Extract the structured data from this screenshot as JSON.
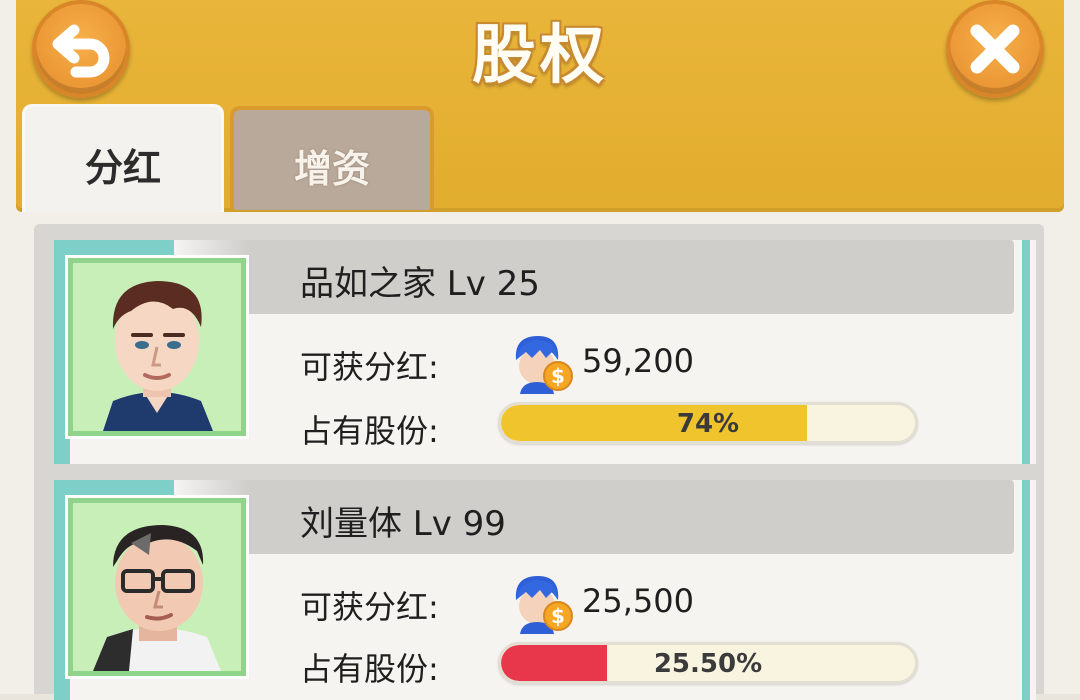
{
  "window": {
    "title": "股权"
  },
  "tabs": [
    {
      "label": "分红",
      "active": true
    },
    {
      "label": "增资",
      "active": false
    }
  ],
  "players": [
    {
      "name_line": "品如之家 Lv 25",
      "dividend_label": "可获分红:",
      "dividend_value": "59,200",
      "share_label": "占有股份:",
      "share_text": "74%",
      "share_fraction": 0.74,
      "bar_color": "#f0c42c",
      "avatar_icon": "avatar-man-brown-hair-icon"
    },
    {
      "name_line": "刘量体 Lv 99",
      "dividend_label": "可获分红:",
      "dividend_value": "25,500",
      "share_label": "占有股份:",
      "share_text": "25.50%",
      "share_fraction": 0.255,
      "bar_color": "#e8364a",
      "avatar_icon": "avatar-man-glasses-icon"
    }
  ],
  "colors": {
    "header": "#e6b236",
    "button": "#ec982f",
    "teal": "#7dcfc7",
    "avatar_bg": "#c9efb9"
  },
  "icons": {
    "back": "back-arrow-icon",
    "close": "close-x-icon",
    "dividend": "coin-person-icon"
  }
}
